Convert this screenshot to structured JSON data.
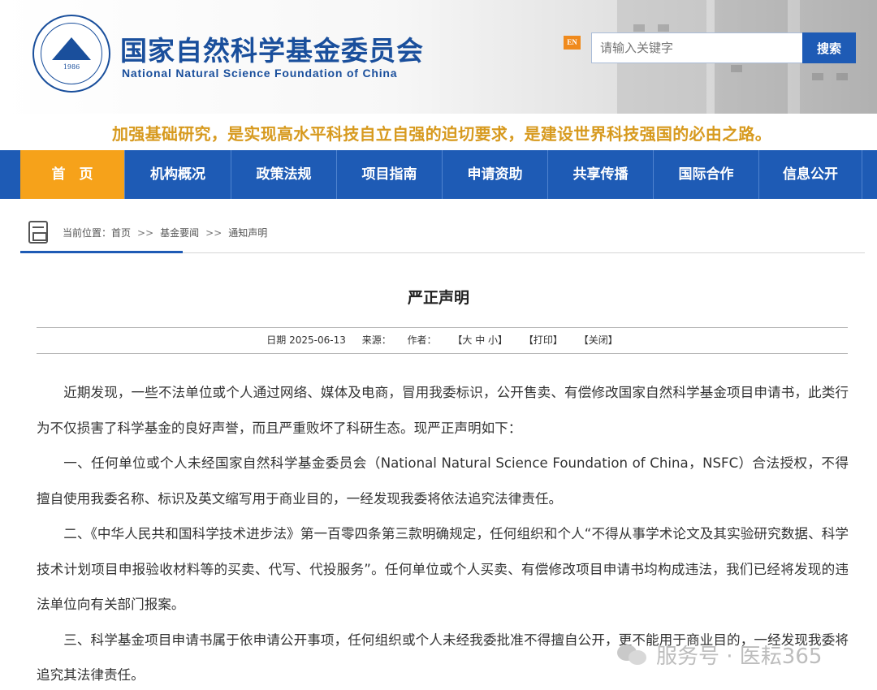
{
  "header": {
    "org_name_cn": "国家自然科学基金委员会",
    "org_name_en": "National Natural Science Foundation of China",
    "logo_year": "1986",
    "lang_switch": "EN",
    "search_placeholder": "请输入关键字",
    "search_button": "搜索"
  },
  "slogan": "加强基础研究，是实现高水平科技自立自强的迫切要求，是建设世界科技强国的必由之路。",
  "nav": {
    "items": [
      {
        "label": "首　页"
      },
      {
        "label": "机构概况"
      },
      {
        "label": "政策法规"
      },
      {
        "label": "项目指南"
      },
      {
        "label": "申请资助"
      },
      {
        "label": "共享传播"
      },
      {
        "label": "国际合作"
      },
      {
        "label": "信息公开"
      }
    ]
  },
  "breadcrumb": {
    "prefix": "当前位置：",
    "items": [
      "首页",
      "基金要闻",
      "通知声明"
    ],
    "separator": ">>"
  },
  "article": {
    "title": "严正声明",
    "meta": {
      "date": "日期 2025-06-13",
      "source": "来源：",
      "author": "作者：",
      "font_size": "【大 中 小】",
      "print": "【打印】",
      "close": "【关闭】"
    },
    "paragraphs": [
      "近期发现，一些不法单位或个人通过网络、媒体及电商，冒用我委标识，公开售卖、有偿修改国家自然科学基金项目申请书，此类行为不仅损害了科学基金的良好声誉，而且严重败坏了科研生态。现严正声明如下：",
      "一、任何单位或个人未经国家自然科学基金委员会（National Natural Science Foundation of China，NSFC）合法授权，不得擅自使用我委名称、标识及英文缩写用于商业目的，一经发现我委将依法追究法律责任。",
      "二、《中华人民共和国科学技术进步法》第一百零四条第三款明确规定，任何组织和个人“不得从事学术论文及其实验研究数据、科学技术计划项目申报验收材料等的买卖、代写、代投服务”。任何单位或个人买卖、有偿修改项目申请书均构成违法，我们已经将发现的违法单位向有关部门报案。",
      "三、科学基金项目申请书属于依申请公开事项，任何组织或个人未经我委批准不得擅自公开，更不能用于商业目的，一经发现我委将追究其法律责任。"
    ]
  },
  "watermark": "服务号 · 医耘365",
  "colors": {
    "brand_blue": "#1e5bb5",
    "nav_active": "#f6a21a",
    "slogan_gold": "#d79a1f"
  }
}
